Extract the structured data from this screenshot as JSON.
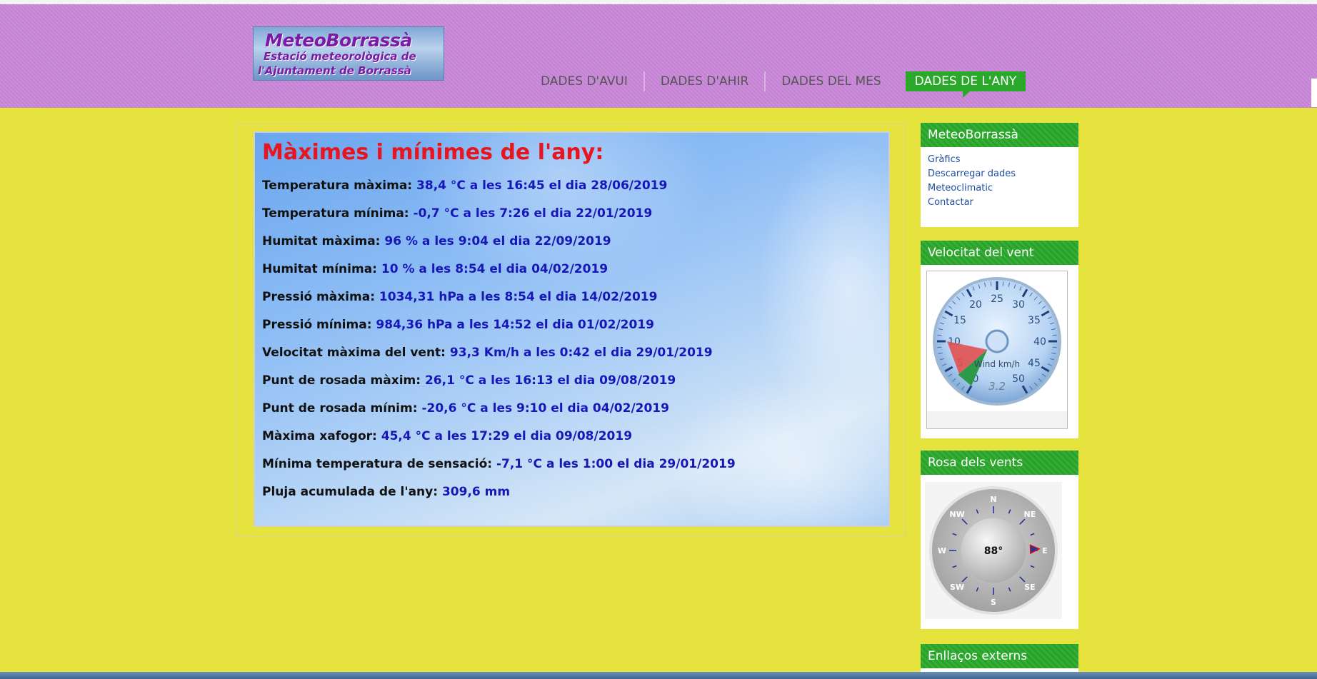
{
  "logo": {
    "line1": "MeteoBorrassà",
    "line2": "Estació meteorològica de",
    "line3": "l'Ajuntament de Borrassà"
  },
  "nav": {
    "items": [
      {
        "label": "DADES D'AVUI"
      },
      {
        "label": "DADES D'AHIR"
      },
      {
        "label": "DADES DEL MES"
      },
      {
        "label": "DADES DE L'ANY"
      }
    ],
    "active_color": "#2aa82a"
  },
  "main": {
    "title": "Màximes i mínimes de l'any:",
    "rows": [
      {
        "label": "Temperatura màxima:",
        "value": "38,4 °C a les 16:45 el dia 28/06/2019"
      },
      {
        "label": "Temperatura mínima:",
        "value": "-0,7 °C a les 7:26 el dia 22/01/2019"
      },
      {
        "label": "Humitat màxima:",
        "value": "96 % a les 9:04 el dia 22/09/2019"
      },
      {
        "label": "Humitat mínima:",
        "value": "10 % a les 8:54 el dia 04/02/2019"
      },
      {
        "label": "Pressió màxima:",
        "value": "1034,31 hPa a les 8:54 el dia 14/02/2019"
      },
      {
        "label": "Pressió mínima:",
        "value": "984,36 hPa a les 14:52 el dia 01/02/2019"
      },
      {
        "label": "Velocitat màxima del vent:",
        "value": "93,3 Km/h a les 0:42 el dia 29/01/2019"
      },
      {
        "label": "Punt de rosada màxim:",
        "value": "26,1 °C a les 16:13 el dia 09/08/2019"
      },
      {
        "label": "Punt de rosada mínim:",
        "value": "-20,6 °C a les 9:10 el dia 04/02/2019"
      },
      {
        "label": "Màxima xafogor:",
        "value": "45,4 °C a les 17:29 el dia 09/08/2019"
      },
      {
        "label": "Mínima temperatura de sensació:",
        "value": "-7,1 °C a les 1:00 el dia 29/01/2019"
      },
      {
        "label": "Pluja acumulada de l'any:",
        "value": "309,6 mm"
      }
    ]
  },
  "sidebar": {
    "meteo": {
      "title": "MeteoBorrassà",
      "links": [
        "Gràfics",
        "Descarregar dades",
        "Meteoclimatic",
        "Contactar"
      ]
    },
    "wind": {
      "title": "Velocitat del vent",
      "gauge_label": "Wind km/h",
      "readout": "3.2",
      "ticks": [
        "0",
        "5",
        "10",
        "15",
        "20",
        "25",
        "30",
        "35",
        "40",
        "45",
        "50"
      ],
      "value": 3.2,
      "max": 50
    },
    "rose": {
      "title": "Rosa dels vents",
      "directions": [
        "N",
        "NE",
        "E",
        "SE",
        "S",
        "SW",
        "W",
        "NW"
      ],
      "bearing_text": "88°",
      "bearing": 88
    },
    "links_ext": {
      "title": "Enllaços externs"
    }
  }
}
